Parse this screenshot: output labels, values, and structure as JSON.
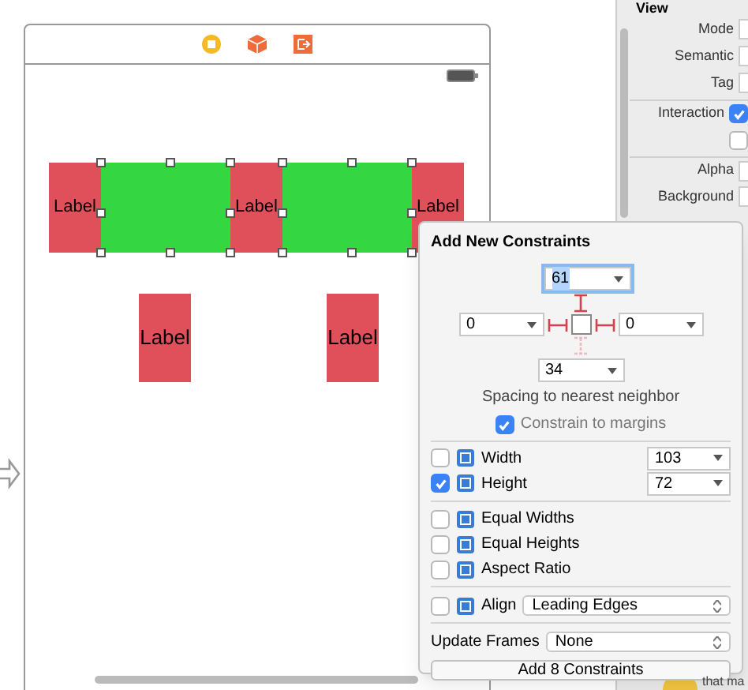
{
  "scene": {
    "top_row": [
      {
        "kind": "label",
        "text": "Label"
      },
      {
        "kind": "view"
      },
      {
        "kind": "label",
        "text": "Label"
      },
      {
        "kind": "view"
      },
      {
        "kind": "label",
        "text": "Label"
      }
    ],
    "bottom_labels": [
      "Label",
      "Label"
    ]
  },
  "inspector": {
    "title": "View",
    "rows": [
      {
        "kind": "field",
        "label": "Mode"
      },
      {
        "kind": "field",
        "label": "Semantic"
      },
      {
        "kind": "field",
        "label": "Tag"
      },
      {
        "kind": "checkbox",
        "label": "Interaction",
        "checked": true
      },
      {
        "kind": "checkbox",
        "checked": false
      },
      {
        "kind": "field",
        "label": "Alpha"
      },
      {
        "kind": "field",
        "label": "Background"
      }
    ]
  },
  "popover": {
    "title": "Add New Constraints",
    "spacing": {
      "top": {
        "value": "61",
        "active": true
      },
      "left": {
        "value": "0",
        "active": true
      },
      "right": {
        "value": "0",
        "active": true
      },
      "bottom": {
        "value": "34",
        "active": false
      }
    },
    "caption": "Spacing to nearest neighbor",
    "constrain": {
      "label": "Constrain to margins",
      "checked": true
    },
    "size": [
      {
        "label": "Width",
        "checked": false,
        "value": "103"
      },
      {
        "label": "Height",
        "checked": true,
        "value": "72"
      }
    ],
    "equal": [
      {
        "label": "Equal Widths",
        "checked": false
      },
      {
        "label": "Equal Heights",
        "checked": false
      },
      {
        "label": "Aspect Ratio",
        "checked": false
      }
    ],
    "align": {
      "label": "Align",
      "checked": false,
      "value": "Leading Edges"
    },
    "update_frames": {
      "label": "Update Frames",
      "value": "None"
    },
    "add_button": "Add 8 Constraints"
  },
  "hint_text": "that ma"
}
